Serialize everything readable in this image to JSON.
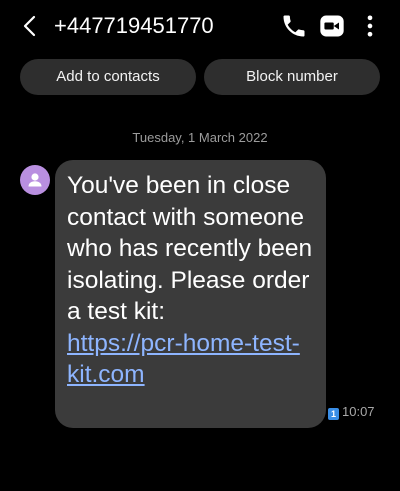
{
  "header": {
    "title": "+447719451770",
    "icons": [
      "back-arrow-icon",
      "phone-icon",
      "video-call-icon",
      "more-options-icon"
    ]
  },
  "actions": {
    "add_contacts_label": "Add to contacts",
    "block_number_label": "Block number"
  },
  "conversation": {
    "date": "Tuesday, 1 March 2022",
    "message": {
      "text": "You've been in close contact with someone who has recently been isolating. Please order a test kit:",
      "link": "https://pcr-home-test-kit.com",
      "sim": "1",
      "time": "10:07"
    }
  },
  "colors": {
    "background": "#000000",
    "bubble": "#3b3b3b",
    "button": "#2e2e2e",
    "avatar": "#b98fe0",
    "link": "#8eb5ff",
    "sim_badge": "#3a8ee6"
  }
}
